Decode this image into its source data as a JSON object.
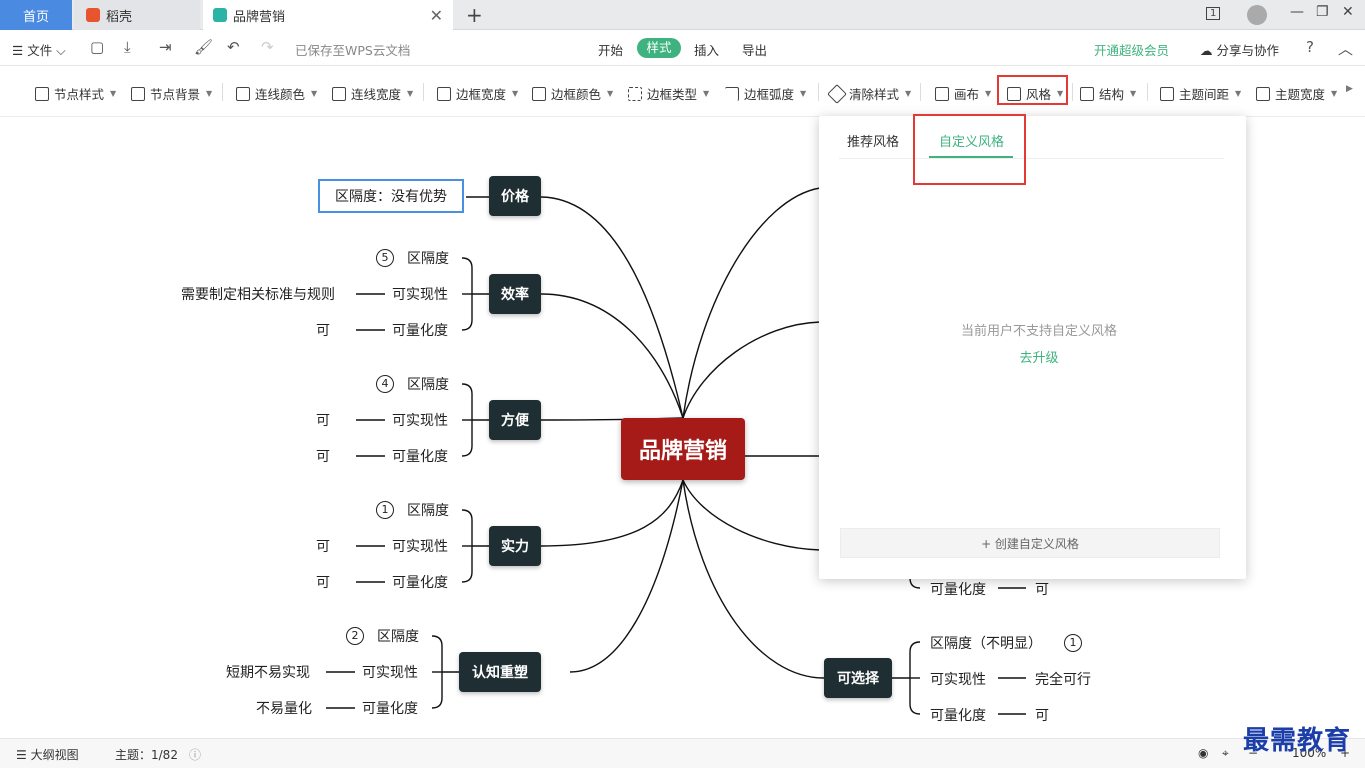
{
  "tabs": {
    "home": "首页",
    "daoke": "稻壳",
    "doc": "品牌营销"
  },
  "menubar": {
    "file": "文件",
    "saved": "已保存至WPS云文档",
    "tabs": [
      "开始",
      "样式",
      "插入",
      "导出"
    ],
    "vip": "开通超级会员",
    "share": "分享与协作"
  },
  "toolbar": {
    "items": [
      "节点样式",
      "节点背景",
      "连线颜色",
      "连线宽度",
      "边框宽度",
      "边框颜色",
      "边框类型",
      "边框弧度",
      "清除样式",
      "画布",
      "风格",
      "结构",
      "主题间距",
      "主题宽度"
    ]
  },
  "mindmap": {
    "central": "品牌营销",
    "left": [
      {
        "label": "价格",
        "note": "区隔度：没有优势"
      },
      {
        "label": "效率",
        "children": [
          {
            "text": "区隔度",
            "badge": "5"
          },
          {
            "text": "可实现性",
            "detail": "需要制定相关标准与规则"
          },
          {
            "text": "可量化度",
            "detail": "可"
          }
        ]
      },
      {
        "label": "方便",
        "children": [
          {
            "text": "区隔度",
            "badge": "4"
          },
          {
            "text": "可实现性",
            "detail": "可"
          },
          {
            "text": "可量化度",
            "detail": "可"
          }
        ]
      },
      {
        "label": "实力",
        "children": [
          {
            "text": "区隔度",
            "badge": "1"
          },
          {
            "text": "可实现性",
            "detail": "可"
          },
          {
            "text": "可量化度",
            "detail": "可"
          }
        ]
      },
      {
        "label": "认知重塑",
        "children": [
          {
            "text": "区隔度",
            "badge": "2"
          },
          {
            "text": "可实现性",
            "detail": "短期不易实现"
          },
          {
            "text": "可量化度",
            "detail": "不易量化"
          }
        ]
      }
    ],
    "right": [
      {
        "label": "可选择",
        "children": [
          {
            "text": "区隔度（不明显）",
            "badge": "1"
          },
          {
            "text": "可实现性",
            "detail": "完全可行"
          },
          {
            "text": "可量化度",
            "detail": "可"
          }
        ]
      }
    ],
    "partial_right_leaf": {
      "text": "可量化度",
      "detail": "可"
    }
  },
  "style_panel": {
    "tab_recommended": "推荐风格",
    "tab_custom": "自定义风格",
    "message": "当前用户不支持自定义风格",
    "upgrade": "去升级",
    "create": "+ 创建自定义风格"
  },
  "statusbar": {
    "outline": "大纲视图",
    "topics": "主题：1/82",
    "zoom": "100%"
  },
  "watermark": "最需教育"
}
